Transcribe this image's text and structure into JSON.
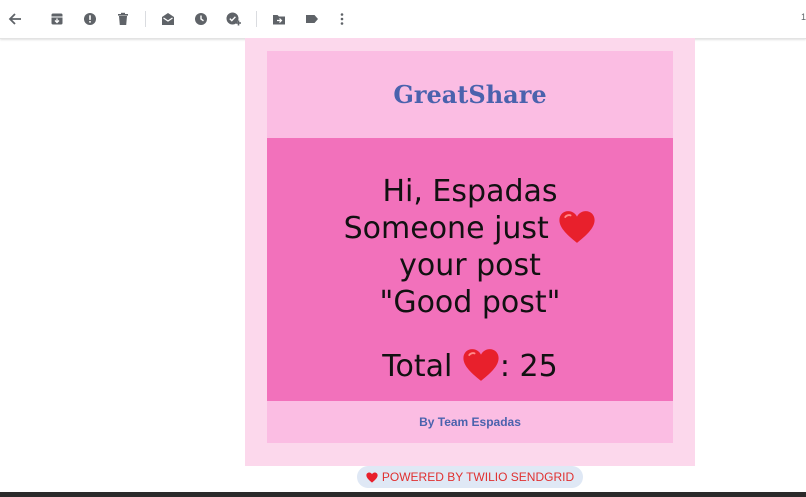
{
  "toolbar": {
    "icons": [
      "back-arrow-icon",
      "archive-icon",
      "report-spam-icon",
      "delete-icon",
      "mark-as-read-icon",
      "snooze-icon",
      "add-to-tasks-icon",
      "move-to-icon",
      "label-icon",
      "more-options-icon"
    ],
    "page_indicator": "1"
  },
  "email": {
    "brand": "GreatShare",
    "greeting": "Hi, Espadas",
    "line_someone": "Someone just",
    "line_your_post": "your post",
    "post_title": "\"Good post\"",
    "total_label": "Total",
    "total_count": ": 25",
    "signature": "By Team Espadas"
  },
  "powered_by": "POWERED BY TWILIO SENDGRID",
  "colors": {
    "outer": "#fcd8ec",
    "header": "#fbbde3",
    "main": "#f271bb",
    "brand_text": "#4a62ad",
    "heart": "#e8202c"
  }
}
